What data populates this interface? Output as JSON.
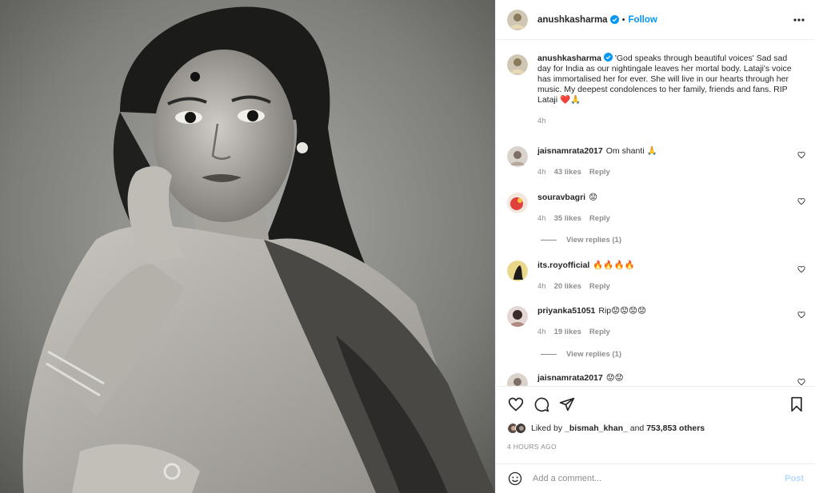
{
  "header": {
    "username": "anushkasharma",
    "follow_label": "Follow",
    "more_icon": "more-horizontal-icon"
  },
  "caption": {
    "username": "anushkasharma",
    "text": " 'God speaks through beautiful voices' Sad sad day for India as our nightingale leaves her mortal body. Lataji's voice has immortalised her for ever. She will live in our hearts through her music. My deepest condolences to her family, friends and fans. RIP Lataji ❤️🙏",
    "time": "4h"
  },
  "comments": [
    {
      "username": "jaisnamrata2017",
      "text": "Om shanti 🙏",
      "time": "4h",
      "likes": "43 likes",
      "reply": "Reply"
    },
    {
      "username": "souravbagri",
      "text": "😟",
      "time": "4h",
      "likes": "35 likes",
      "reply": "Reply",
      "view_replies": "View replies (1)"
    },
    {
      "username": "its.royofficial",
      "text": "🔥🔥🔥🔥",
      "time": "4h",
      "likes": "20 likes",
      "reply": "Reply"
    },
    {
      "username": "priyanka51051",
      "text": "Rip😟😟😟😟",
      "time": "4h",
      "likes": "19 likes",
      "reply": "Reply",
      "view_replies": "View replies (1)"
    },
    {
      "username": "jaisnamrata2017",
      "text": "😟😟"
    }
  ],
  "actions": {
    "like_icon": "heart-icon",
    "comment_icon": "comment-icon",
    "share_icon": "share-icon",
    "save_icon": "bookmark-icon"
  },
  "likes": {
    "prefix": "Liked by ",
    "user": "_bismah_khan_",
    "middle": " and ",
    "count": "753,853 others"
  },
  "post_time": "4 HOURS AGO",
  "add_comment": {
    "placeholder": "Add a comment...",
    "post_label": "Post"
  },
  "colors": {
    "accent": "#0095f6",
    "text": "#262626",
    "muted": "#8e8e8e",
    "heart": "#ed4956"
  }
}
